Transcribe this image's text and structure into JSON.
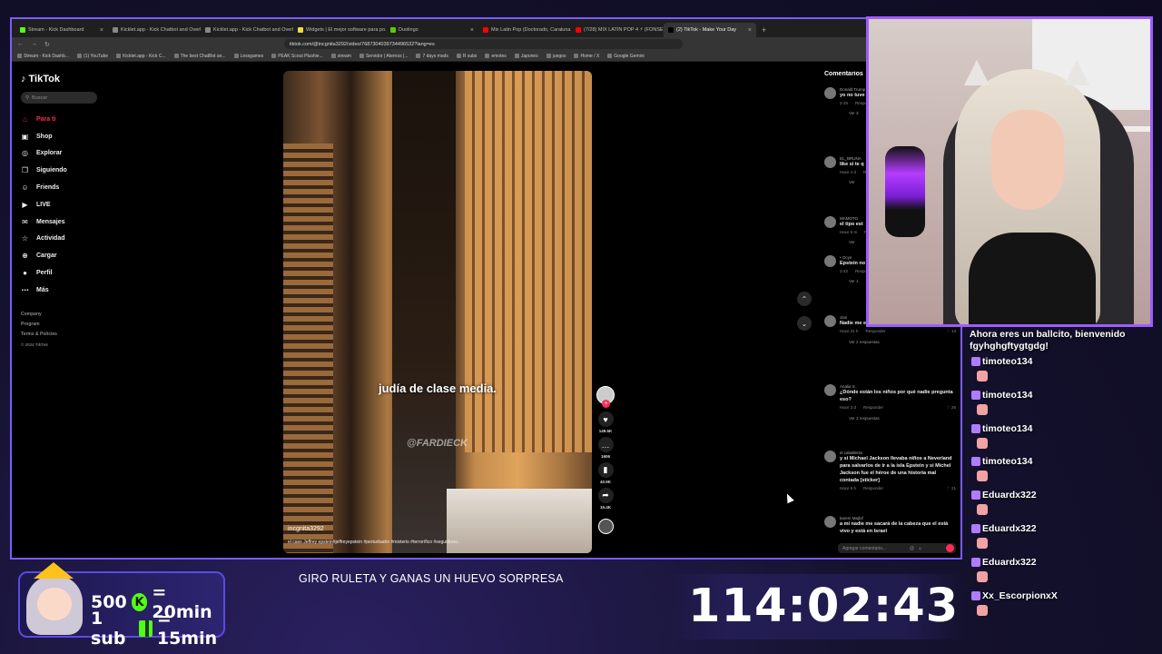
{
  "browser": {
    "tabs": [
      {
        "label": "Stream - Kick Dashboard",
        "color": "#53fc18"
      },
      {
        "label": "Kicklet.app - Kick Chatbot and Overl...",
        "color": "#888888"
      },
      {
        "label": "Kicklet.app - Kick Chatbot and Overl...",
        "color": "#888888"
      },
      {
        "label": "Widgets | El mejor software para po...",
        "color": "#f5d547"
      },
      {
        "label": "Duolingo",
        "color": "#58cc02"
      },
      {
        "label": "Mix Latin Pop (Doctorado, Caraluna...",
        "color": "#ff0000"
      },
      {
        "label": "(7/28) MIX LATIN POP 4 ⚡ (FONSEC...",
        "color": "#ff0000"
      },
      {
        "label": "(2) TikTok - Make Your Day",
        "color": "#000000"
      }
    ],
    "new_tab": "+",
    "url": "tiktok.com/@incgnita3292/video/7687304039734496532?lang=es",
    "bookmarks": [
      "Stream - Kick Dashb...",
      "(1) YouTube",
      "Kicklet.app - Kick C...",
      "The best ChatBot an...",
      "Lessgames",
      "PEAK Scout Plushie...",
      "stream",
      "Servidor | Aternos |...",
      "7 days mods",
      "R subs",
      "emotes",
      "Japones",
      "juegos",
      "Home / X",
      "Google Gemini"
    ]
  },
  "tiktok": {
    "logo": "TikTok",
    "search_placeholder": "Buscar",
    "nav": [
      {
        "label": "Para ti",
        "icon": "home-icon",
        "glyph": "⌂"
      },
      {
        "label": "Shop",
        "icon": "shop-icon",
        "glyph": "▣"
      },
      {
        "label": "Explorar",
        "icon": "compass-icon",
        "glyph": "◎"
      },
      {
        "label": "Siguiendo",
        "icon": "following-icon",
        "glyph": "❐"
      },
      {
        "label": "Friends",
        "icon": "friends-icon",
        "glyph": "☺"
      },
      {
        "label": "LIVE",
        "icon": "live-icon",
        "glyph": "▶"
      },
      {
        "label": "Mensajes",
        "icon": "messages-icon",
        "glyph": "✉"
      },
      {
        "label": "Actividad",
        "icon": "activity-icon",
        "glyph": "☆"
      },
      {
        "label": "Cargar",
        "icon": "upload-icon",
        "glyph": "⊕"
      },
      {
        "label": "Perfil",
        "icon": "profile-icon",
        "glyph": "●"
      },
      {
        "label": "Más",
        "icon": "more-icon",
        "glyph": "⋯"
      }
    ],
    "footer": [
      "Company",
      "Program",
      "Terms & Policies"
    ],
    "copyright": "© 2024 TikTok",
    "video": {
      "caption": "judía de clase media.",
      "watermark": "@FARDIECK",
      "username": "incgnita3292",
      "description": "el caso Jeffrey epstein#jeffreyepstein #perturbador #misterio #terrorífico #seguidores"
    },
    "actions": [
      {
        "name": "like",
        "glyph": "♥",
        "count": "149.5K"
      },
      {
        "name": "comment",
        "glyph": "…",
        "count": "1606"
      },
      {
        "name": "save",
        "glyph": "▮",
        "count": "40.9K"
      },
      {
        "name": "share",
        "glyph": "➦",
        "count": "15.4K"
      }
    ],
    "scroll_up": "⌃",
    "scroll_down": "⌄",
    "comments_title": "Comentarios",
    "comments": [
      {
        "name": "Donald Trump",
        "text": "yo no tuve",
        "date": "2-25",
        "reply": "Responder",
        "likes": "",
        "more": "Ver 3"
      },
      {
        "name": "EL_BRUNA",
        "text": "like si te q",
        "date": "Hace 4 d",
        "reply": "Responder",
        "likes": "",
        "more": "Ver"
      },
      {
        "name": "MAMOTO",
        "text": "el tipo est",
        "date": "Hace 5 m",
        "reply": "Responder",
        "likes": "",
        "more": "Ver"
      },
      {
        "name": "• Ocyn",
        "text": "Epstein no una caja c",
        "date": "2-22",
        "reply": "Responder",
        "likes": "",
        "more": "Ver 1"
      },
      {
        "name": "clari",
        "text": "Nadie me epstein si",
        "date": "Hace 21 h",
        "reply": "Responder",
        "likes": "13",
        "more": "Ver 2 respuestas"
      },
      {
        "name": "Analia S",
        "text": "¿Dónde están los niños por qué nadie pregunta eso?",
        "date": "Hace 3 d",
        "reply": "Responder",
        "likes": "26",
        "more": "Ver 3 respuestas"
      },
      {
        "name": "el caballerito",
        "text": "y si Michael Jackson llevaba niños a Neverland para salvarlos de ir a la isla Epstein y si Michel Jackson fue el héroe de una historia mal contada [sticker]",
        "date": "Hace 6 h",
        "reply": "Responder",
        "likes": "21",
        "more": ""
      },
      {
        "name": "karem Majlof",
        "text": "a mí nadie me sacará de la cabeza que el está vivo y está en Israel",
        "date": "",
        "reply": "",
        "likes": "",
        "more": ""
      }
    ],
    "comment_placeholder": "Agregar comentario..."
  },
  "chat": {
    "message": "Ahora eres un ballcito, bienvenido fgyhghgftygtgdg!",
    "users": [
      "timoteo134",
      "timoteo134",
      "timoteo134",
      "timoteo134",
      "Eduardx322",
      "Eduardx322",
      "Eduardx322",
      "Xx_EscorpionxX"
    ]
  },
  "overlay": {
    "ticker": "GIRO RULETA Y GANAS UN HUEVO SORPRESA",
    "timer": "114:02:43",
    "promo_line1_left": "500",
    "promo_line1_right": "= 20min",
    "promo_line2_left": "1 sub",
    "promo_line2_right": "= 15min",
    "kick_letter": "K",
    "accent": "#53fc18",
    "frame_color": "#7a5cff"
  }
}
